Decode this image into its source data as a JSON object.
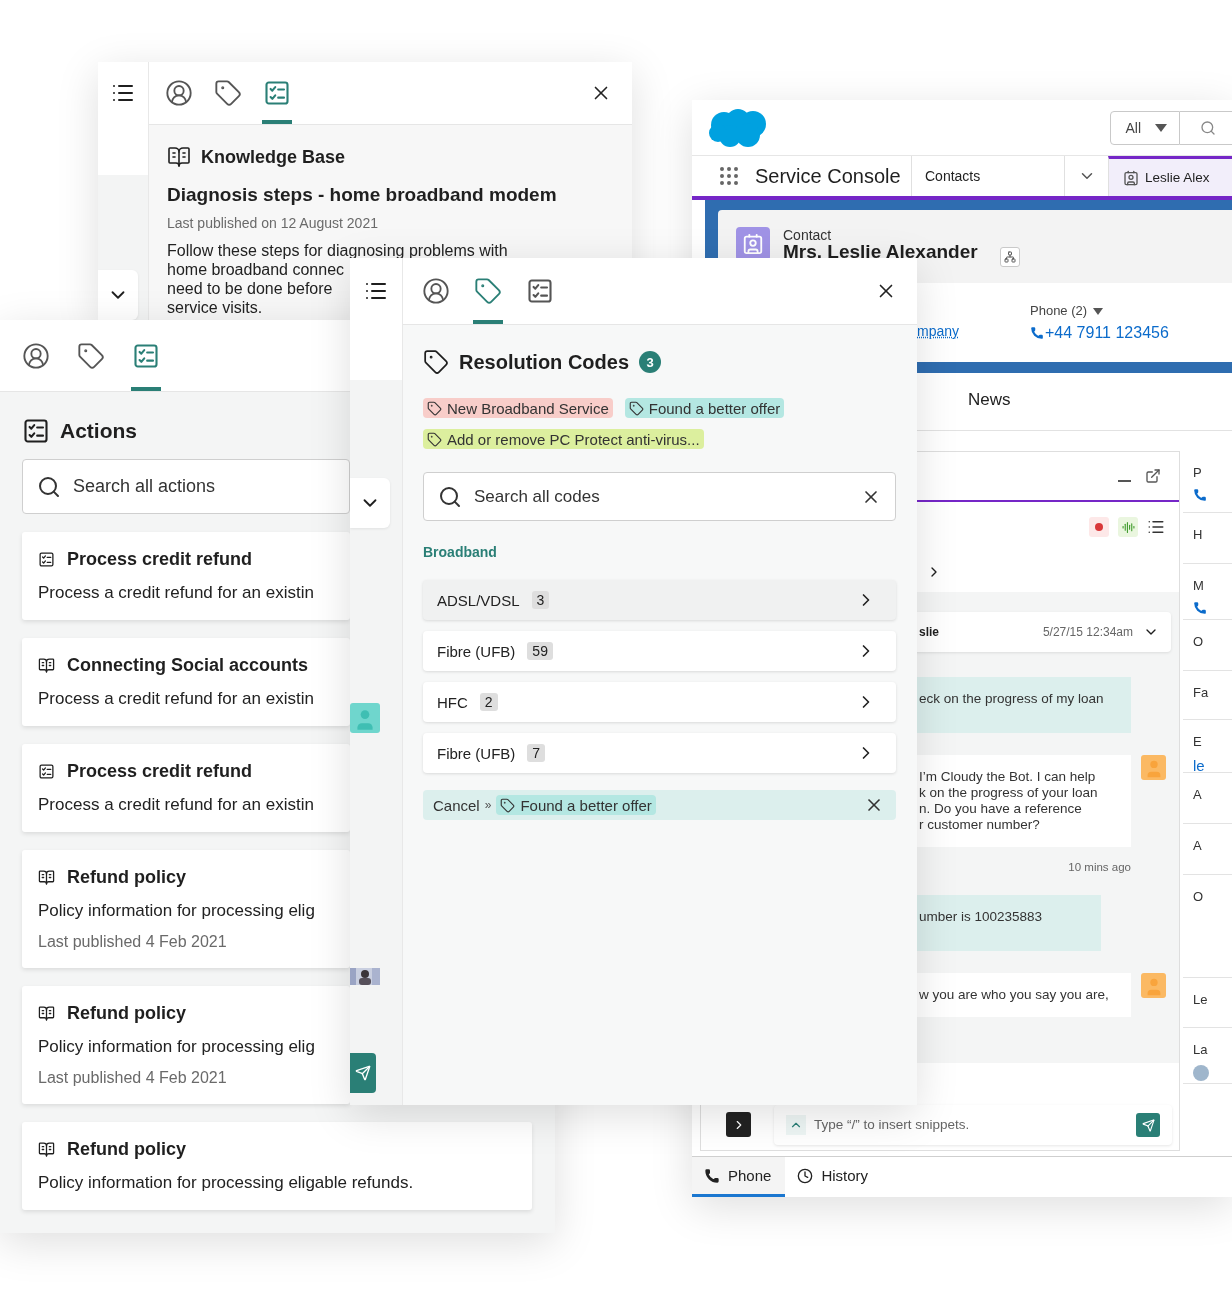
{
  "knowledge_window": {
    "tabs": [
      {
        "kind": "profile",
        "selected": false
      },
      {
        "kind": "tags",
        "selected": false
      },
      {
        "kind": "checklist",
        "selected": true
      }
    ],
    "heading": "Knowledge Base",
    "article_title": "Diagnosis steps - home broadband modem",
    "published": "Last published on 12 August 2021",
    "body_lines": [
      "Follow these steps for diagnosing problems with",
      "home broadband connec",
      "need to be done before",
      "service visits."
    ]
  },
  "actions_window": {
    "tabs": [
      {
        "kind": "profile",
        "selected": false
      },
      {
        "kind": "tags",
        "selected": false
      },
      {
        "kind": "checklist",
        "selected": true
      }
    ],
    "heading": "Actions",
    "search_placeholder": "Search all actions",
    "cards": [
      {
        "kind": "action",
        "title": "Process credit refund",
        "description": "Process a credit refund for an existin"
      },
      {
        "kind": "article",
        "title": "Connecting Social accounts",
        "description": "Process a credit refund for an existin"
      },
      {
        "kind": "action",
        "title": "Process credit refund",
        "description": "Process a credit refund for an existin"
      },
      {
        "kind": "article",
        "title": "Refund policy",
        "description": "Policy information for processing elig",
        "published": "Last published 4 Feb 2021"
      },
      {
        "kind": "article",
        "title": "Refund policy",
        "description": "Policy information for processing elig",
        "published": "Last published 4 Feb 2021"
      },
      {
        "kind": "article",
        "title": "Refund policy",
        "description": "Policy information for processing eligable refunds."
      }
    ]
  },
  "codes_window": {
    "tabs": [
      {
        "kind": "profile",
        "selected": false
      },
      {
        "kind": "tags",
        "selected": true
      },
      {
        "kind": "checklist",
        "selected": false
      }
    ],
    "heading": "Resolution Codes",
    "count": "3",
    "applied_tags": [
      {
        "label": "New Broadband Service",
        "color": "#f8cdc9"
      },
      {
        "label": "Found a better offer",
        "color": "#b4e7e2"
      },
      {
        "label": "Add or remove PC Protect anti-virus...",
        "color": "#dcef9e"
      }
    ],
    "search_placeholder": "Search all codes",
    "group": "Broadband",
    "codes": [
      {
        "label": "ADSL/VDSL",
        "count": "3",
        "selected": true
      },
      {
        "label": "Fibre (UFB)",
        "count": "59",
        "selected": false
      },
      {
        "label": "HFC",
        "count": "2",
        "selected": false
      },
      {
        "label": "Fibre (UFB)",
        "count": "7",
        "selected": false
      }
    ],
    "pending": {
      "action": "Cancel",
      "separator": "»",
      "tag": "Found a better offer"
    }
  },
  "console": {
    "search_scope": "All",
    "app_name": "Service Console",
    "nav_item": "Contacts",
    "open_tabs": [
      {
        "label": "Leslie Alex",
        "selected": true
      }
    ],
    "record_type": "Contact",
    "record_name": "Mrs. Leslie Alexander",
    "company_fragment": "mpany",
    "phone_label": "Phone (2)",
    "phone": "+44 7911 123456",
    "detail_tabs": [
      {
        "label": "News",
        "selected": false
      }
    ],
    "chat": {
      "recording": true,
      "contact_fragment": "slie",
      "timestamp": "5/27/15 12:34am",
      "messages": [
        {
          "kind": "customer",
          "lines": [
            "eck on the progress of my loan"
          ]
        },
        {
          "kind": "bot",
          "lines": [
            "I’m Cloudy the Bot. I can help",
            "k on the progress of your loan",
            "n. Do you have a reference",
            "r customer number?"
          ]
        },
        {
          "kind": "time",
          "lines": [
            "10 mins ago"
          ]
        },
        {
          "kind": "customer",
          "lines": [
            "umber is 100235883"
          ]
        },
        {
          "kind": "bot",
          "lines": [
            "w you are who you say you are,"
          ]
        }
      ],
      "composer_placeholder": "Type “/” to insert snippets."
    },
    "utility_tabs": [
      {
        "kind": "phone",
        "label": "Phone",
        "selected": true
      },
      {
        "kind": "history",
        "label": "History",
        "selected": false
      }
    ],
    "side_fields": [
      {
        "kind": "phone",
        "label": "P"
      },
      {
        "kind": "plain",
        "label": "H"
      },
      {
        "kind": "phone",
        "label": "M"
      },
      {
        "kind": "plain",
        "label": "O"
      },
      {
        "kind": "plain",
        "label": "Fa"
      },
      {
        "kind": "link",
        "label": "E",
        "value": "le"
      },
      {
        "kind": "plain",
        "label": "A"
      },
      {
        "kind": "plain",
        "label": "A"
      },
      {
        "kind": "plain",
        "label": "O"
      },
      {
        "kind": "plain",
        "label": "Le"
      },
      {
        "kind": "avatar",
        "label": "La"
      }
    ]
  }
}
